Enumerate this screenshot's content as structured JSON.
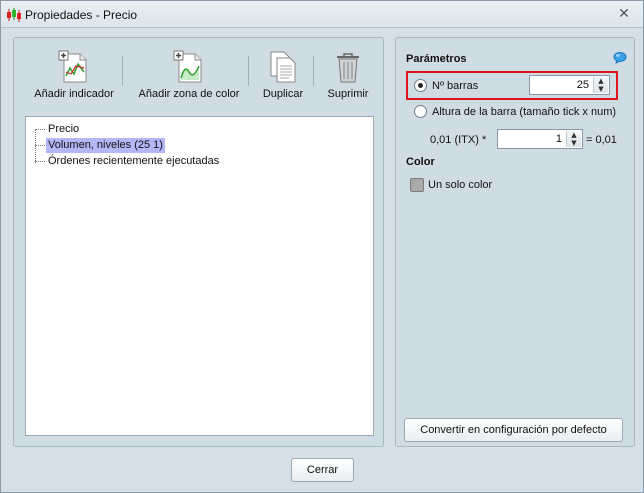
{
  "window": {
    "title": "Propiedades - Precio",
    "close_glyph": "✕"
  },
  "toolbar": {
    "add_indicator": "Añadir indicador",
    "add_color_zone": "Añadir zona de color",
    "duplicate": "Duplicar",
    "delete": "Suprimir"
  },
  "tree": {
    "items": [
      {
        "label": "Precio",
        "selected": false
      },
      {
        "label": "Volumen, niveles (25 1)",
        "selected": true
      },
      {
        "label": "Órdenes recientemente ejecutadas",
        "selected": false
      }
    ]
  },
  "params": {
    "title": "Parámetros",
    "bars_label": "Nº barras",
    "bars_value": "25",
    "bar_height_label": "Altura de la barra (tamaño tick x num)",
    "tick_prefix": "0,01 (ITX) *",
    "tick_value": "1",
    "tick_result": "= 0,01"
  },
  "color": {
    "title": "Color",
    "single_color_label": "Un solo color",
    "swatch_color": "#a9a9a9"
  },
  "buttons": {
    "convert_default": "Convertir en configuración por defecto",
    "close": "Cerrar"
  },
  "icons": {
    "app": "candlestick-chart-icon",
    "add_indicator": "add-indicator-icon",
    "add_color_zone": "add-color-zone-icon",
    "duplicate": "duplicate-icon",
    "delete": "trash-icon",
    "info": "info-bubble-icon"
  },
  "colors": {
    "highlight_border": "#e0141c",
    "selection": "#b4b7f6",
    "panel": "#d0dce4"
  }
}
